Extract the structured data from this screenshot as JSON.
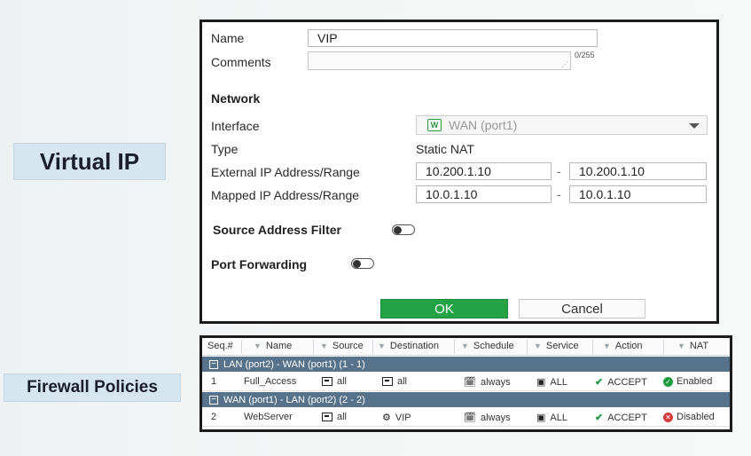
{
  "labels": {
    "virtual_ip": "Virtual IP",
    "firewall_policies": "Firewall Policies"
  },
  "form": {
    "name_label": "Name",
    "name_value": "VIP",
    "comments_label": "Comments",
    "comments_counter": "0/255",
    "network_title": "Network",
    "interface_label": "Interface",
    "interface_value": "WAN (port1)",
    "type_label": "Type",
    "type_value": "Static NAT",
    "external_label": "External IP Address/Range",
    "external_start": "10.200.1.10",
    "external_end": "10.200.1.10",
    "mapped_label": "Mapped IP Address/Range",
    "mapped_start": "10.0.1.10",
    "mapped_end": "10.0.1.10",
    "range_sep": "-",
    "source_filter_label": "Source Address Filter",
    "port_forwarding_label": "Port Forwarding",
    "ok_label": "OK",
    "cancel_label": "Cancel"
  },
  "policy_table": {
    "columns": [
      "Seq.#",
      "Name",
      "Source",
      "Destination",
      "Schedule",
      "Service",
      "Action",
      "NAT"
    ],
    "groups": [
      {
        "label": "LAN (port2) - WAN (port1) (1 - 1)",
        "row": {
          "seq": "1",
          "name": "Full_Access",
          "source": "all",
          "destination": "all",
          "schedule": "always",
          "service": "ALL",
          "action": "ACCEPT",
          "nat": "Enabled"
        }
      },
      {
        "label": "WAN (port1) - LAN (port2) (2 - 2)",
        "row": {
          "seq": "2",
          "name": "WebServer",
          "source": "all",
          "destination": "VIP",
          "schedule": "always",
          "service": "ALL",
          "action": "ACCEPT",
          "nat": "Disabled"
        }
      }
    ]
  },
  "colors": {
    "ok_button": "#23a346",
    "group_row": "#57738b",
    "accept_check": "#1e9a3f",
    "nat_disabled": "#d43a3a"
  }
}
